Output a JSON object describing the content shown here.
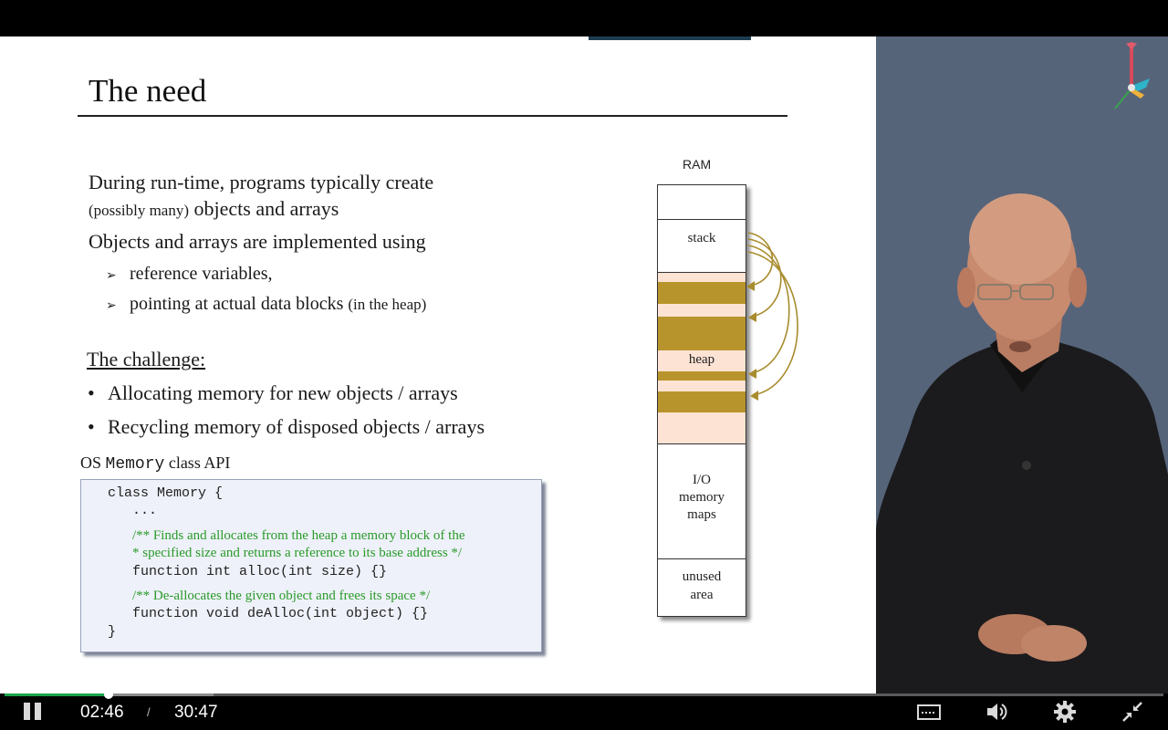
{
  "slide": {
    "title": "The need",
    "intro_line1": "During run-time, programs typically create",
    "intro_line2_small": "(possibly many)",
    "intro_line2": " objects and arrays",
    "impl_line": "Objects and arrays are implemented using",
    "sub_bullets": [
      {
        "mark": "➢",
        "text": "reference variables,",
        "small": ""
      },
      {
        "mark": "➢",
        "text": "pointing at actual data blocks ",
        "small": "(in the heap)"
      }
    ],
    "challenge_heading": "The challenge:",
    "bullets": [
      {
        "mark": "•",
        "text": "Allocating memory for new objects / arrays"
      },
      {
        "mark": "•",
        "text": "Recycling memory of disposed objects / arrays"
      }
    ],
    "api_label_prefix": "OS ",
    "api_label_code": "Memory",
    "api_label_suffix": " class API",
    "code": {
      "line1": "class Memory {",
      "line2": "...",
      "comment1a": "/** Finds and allocates from the heap a memory block of the",
      "comment1b": "*  specified size and returns a reference to its base address */",
      "line3": "function int alloc(int size) {}",
      "comment2": "/** De-allocates the given object and frees its space */",
      "line4": "function void deAlloc(int object) {}",
      "line5": "}"
    }
  },
  "ram": {
    "label": "RAM",
    "stack": "stack",
    "heap": "heap",
    "io1": "I/O",
    "io2": "memory",
    "io3": "maps",
    "unused1": "unused",
    "unused2": "area",
    "heap_color": "#fde3d3",
    "block_color": "#b8952c",
    "arrow_color": "#a88c2e"
  },
  "player": {
    "current_time": "02:46",
    "separator": "/",
    "total_time": "30:47",
    "progress_fraction": 0.09,
    "buffered_fraction": 0.18,
    "accent": "#1aa34a",
    "icons": [
      "pause-icon",
      "captions-icon",
      "volume-icon",
      "settings-gear-icon",
      "exit-fullscreen-icon"
    ]
  }
}
